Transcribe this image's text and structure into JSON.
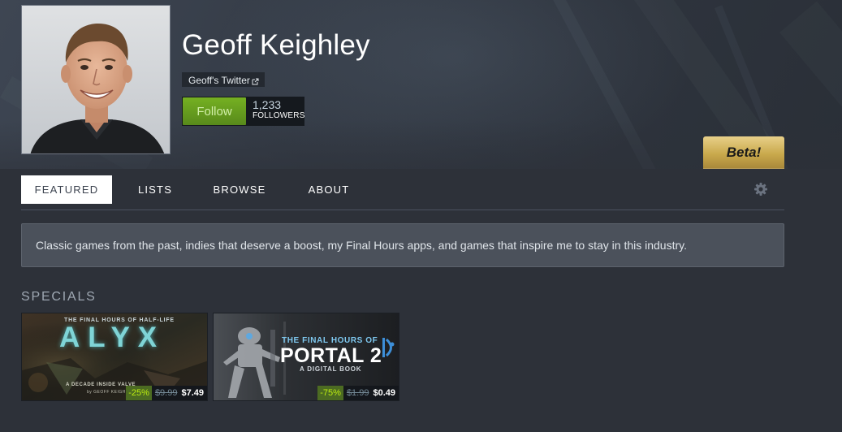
{
  "profile": {
    "name": "Geoff Keighley",
    "twitter_link": "Geoff's Twitter",
    "follow_label": "Follow",
    "followers_count": "1,233",
    "followers_label": "FOLLOWERS",
    "beta_label": "Beta!"
  },
  "tabs": [
    {
      "label": "FEATURED",
      "active": true
    },
    {
      "label": "LISTS",
      "active": false
    },
    {
      "label": "BROWSE",
      "active": false
    },
    {
      "label": "ABOUT",
      "active": false
    }
  ],
  "description": "Classic games from the past, indies that deserve a boost, my Final Hours apps, and games that inspire me to stay in this industry.",
  "specials": {
    "title": "SPECIALS",
    "items": [
      {
        "art_top": "THE FINAL HOURS OF HALF-LIFE",
        "art_title": "ALYX",
        "art_bottom": "A DECADE INSIDE VALVE",
        "art_byline": "by GEOFF KEIGHLEY",
        "discount": "-25%",
        "original_price": "$9.99",
        "final_price": "$7.49"
      },
      {
        "art_top": "THE FINAL HOURS OF",
        "art_title": "PORTAL 2",
        "art_bottom": "A DIGITAL BOOK",
        "discount": "-75%",
        "original_price": "$1.99",
        "final_price": "$0.49"
      }
    ]
  },
  "colors": {
    "background": "#2d3139",
    "follow_green": "#75b022",
    "discount_bg": "#4c6b22",
    "discount_text": "#beee11",
    "beta_gold": "#c9a94c"
  },
  "icons": {
    "external_link": "external-link-icon",
    "settings": "gear-icon"
  }
}
